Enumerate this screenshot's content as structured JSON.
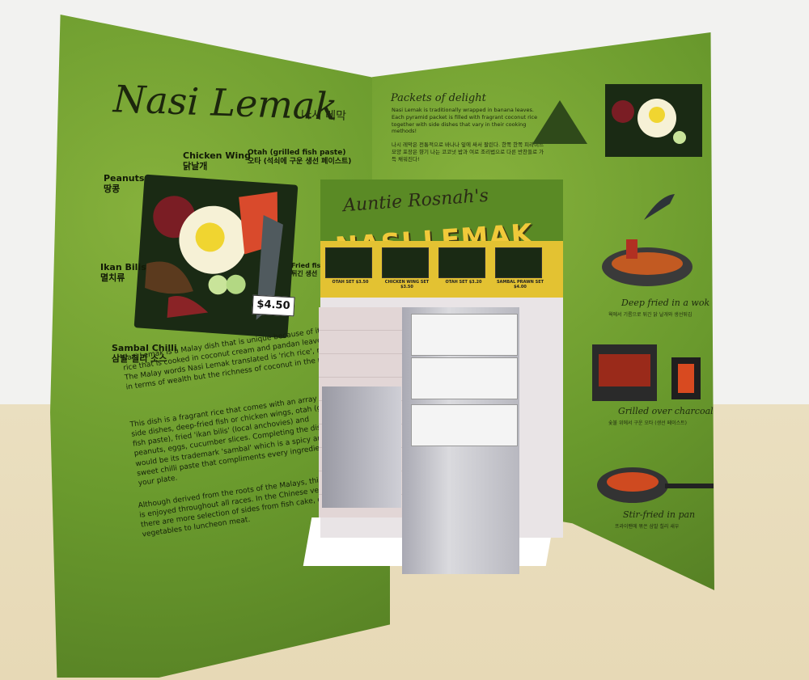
{
  "left_panel": {
    "title": "Nasi Lemak",
    "title_korean": "나시 레막",
    "labels": {
      "peanuts": "Peanuts",
      "peanuts_kr": "땅콩",
      "chicken_wing": "Chicken Wing",
      "chicken_wing_kr": "닭날개",
      "otah": "Otah (grilled fish paste)",
      "otah_kr": "오타 (석쇠에 구운 생선 페이스트)",
      "ikan_bilis": "Ikan Bilis",
      "ikan_bilis_kr": "멸치류",
      "fried_fish": "Fried fish",
      "fried_fish_kr": "튀긴 생선",
      "sambal_chilli": "Sambal Chilli",
      "sambal_chilli_kr": "삼발 칠리 소스"
    },
    "price": "$4.50",
    "paragraphs": [
      "Nasi Lemak is a Malay dish that is unique because of its rice that is cooked in coconut cream and pandan leaves. The Malay words Nasi Lemak translated is 'rich rice', not in terms of wealth but the richness of coconut in the rice.",
      "This dish is a fragrant rice that comes with an array of side dishes, deep-fried fish or chicken wings, otah (grilled fish paste), fried 'ikan bilis' (local anchovies) and peanuts, eggs, cucumber slices. Completing the dish would be its trademark 'sambal' which is a spicy and sweet chilli paste that compliments every ingredient on your plate.",
      "Although derived from the roots of the Malays, this dish is enjoyed throughout all races. In the Chinese version, there are more selection of sides from fish cake, curried vegetables to luncheon meat."
    ]
  },
  "stall": {
    "sign_line1": "Auntie Rosnah's",
    "sign_line2": "NASI LEMAK",
    "menu": [
      {
        "label": "OTAH SET $3.50"
      },
      {
        "label": "CHICKEN WING SET $3.50"
      },
      {
        "label": "OTAH SET $3.20"
      },
      {
        "label": "SAMBAL PRAWN SET $4.00"
      }
    ]
  },
  "right_panel": {
    "heading": "Packets of delight",
    "paragraph": "Nasi Lemak is traditionally wrapped in banana leaves. Each pyramid packet is filled with fragrant coconut rice together with side dishes that vary in their cooking methods!",
    "paragraph_kr": "나시 레막은 전통적으로 바나나 잎에 싸서 팔린다. 한쪽 한쪽 피라미드 모양 포장은 향기 나는 코코넛 밥과 여로 조리법으로 다른 반찬들로 가득 채워진다!",
    "methods": [
      {
        "caption": "Deep fried in a wok",
        "caption_kr": "웍에서 기름으로 튀긴 닭 날개와 생선튀김"
      },
      {
        "caption": "Grilled over charcoal",
        "caption_kr": "숯불 위에서 구운 오타 (생선 페이스트)"
      },
      {
        "caption": "Stir-fried in pan",
        "caption_kr": "프라이팬에 볶은 삼발 칠리 새우"
      }
    ]
  },
  "colors": {
    "card_green": "#6a9a2d",
    "sign_yellow": "#f1c93a",
    "menu_strip": "#e3c232",
    "wall": "#f2f2f0",
    "table": "#e9ddbd"
  }
}
